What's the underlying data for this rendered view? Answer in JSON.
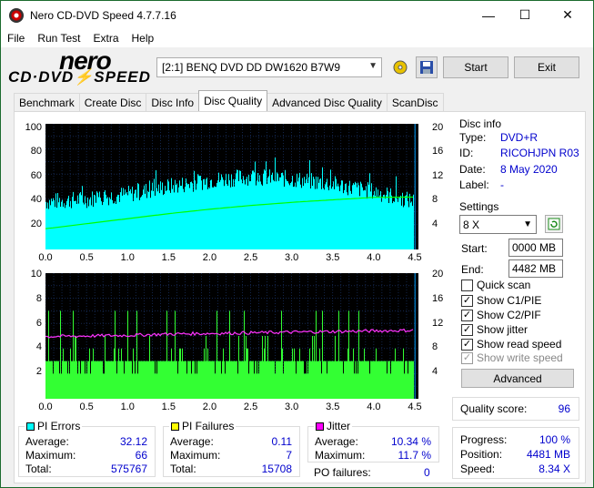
{
  "window": {
    "title": "Nero CD-DVD Speed 4.7.7.16",
    "minimize": "—",
    "maximize": "☐",
    "close": "✕"
  },
  "menu": [
    "File",
    "Run Test",
    "Extra",
    "Help"
  ],
  "logo": {
    "brand": "nero",
    "product": "CD·DVD⚡SPEED"
  },
  "toolbar": {
    "drive": "[2:1]   BENQ DVD DD DW1620 B7W9",
    "start_label": "Start",
    "exit_label": "Exit"
  },
  "tabs": [
    "Benchmark",
    "Create Disc",
    "Disc Info",
    "Disc Quality",
    "Advanced Disc Quality",
    "ScanDisc"
  ],
  "active_tab": "Disc Quality",
  "disc_info": {
    "title": "Disc info",
    "type_label": "Type:",
    "type": "DVD+R",
    "id_label": "ID:",
    "id": "RICOHJPN R03",
    "date_label": "Date:",
    "date": "8 May 2020",
    "label_label": "Label:",
    "label": "-"
  },
  "settings": {
    "title": "Settings",
    "speed": "8 X",
    "start_label": "Start:",
    "start": "0000 MB",
    "end_label": "End:",
    "end": "4482 MB",
    "quick_scan": "Quick scan",
    "show_c1": "Show C1/PIE",
    "show_c2": "Show C2/PIF",
    "show_jitter": "Show jitter",
    "show_read": "Show read speed",
    "show_write": "Show write speed",
    "advanced": "Advanced",
    "checks": {
      "quick_scan": false,
      "show_c1": true,
      "show_c2": true,
      "show_jitter": true,
      "show_read": true,
      "show_write": true
    }
  },
  "quality": {
    "label": "Quality score:",
    "value": "96"
  },
  "progress": {
    "progress_label": "Progress:",
    "progress": "100 %",
    "position_label": "Position:",
    "position": "4481 MB",
    "speed_label": "Speed:",
    "speed": "8.34 X"
  },
  "pi_errors": {
    "title": "PI Errors",
    "color": "#00ffff",
    "avg_label": "Average:",
    "avg": "32.12",
    "max_label": "Maximum:",
    "max": "66",
    "total_label": "Total:",
    "total": "575767"
  },
  "pi_failures": {
    "title": "PI Failures",
    "color": "#ffff00",
    "avg_label": "Average:",
    "avg": "0.11",
    "max_label": "Maximum:",
    "max": "7",
    "total_label": "Total:",
    "total": "15708"
  },
  "jitter": {
    "title": "Jitter",
    "color": "#ff00ff",
    "avg_label": "Average:",
    "avg": "10.34 %",
    "max_label": "Maximum:",
    "max": "11.7 %",
    "po_label": "PO failures:",
    "po": "0"
  },
  "chart_data": [
    {
      "type": "area",
      "title": "",
      "series": [
        {
          "name": "PI Errors",
          "color": "#00ffff"
        },
        {
          "name": "Read speed",
          "color": "#00ff00"
        }
      ],
      "x": [
        0.0,
        0.5,
        1.0,
        1.5,
        2.0,
        2.5,
        3.0,
        3.5,
        4.0,
        4.5
      ],
      "pi_errors": [
        38,
        40,
        44,
        50,
        55,
        58,
        56,
        52,
        46,
        38
      ],
      "read_speed": [
        3.3,
        4.1,
        4.9,
        5.7,
        6.4,
        7.0,
        7.5,
        7.9,
        8.3,
        8.34
      ],
      "xticks": [
        "0.0",
        "0.5",
        "1.0",
        "1.5",
        "2.0",
        "2.5",
        "3.0",
        "3.5",
        "4.0",
        "4.5"
      ],
      "yticks_left": [
        "100",
        "80",
        "60",
        "40",
        "20"
      ],
      "yticks_right": [
        "20",
        "16",
        "12",
        "8",
        "4"
      ],
      "ylim_left": [
        0,
        100
      ],
      "ylim_right": [
        0,
        20
      ],
      "xlim": [
        0,
        4.5
      ],
      "grid": true
    },
    {
      "type": "bar",
      "title": "",
      "series": [
        {
          "name": "PI Failures",
          "color": "#33ff33"
        },
        {
          "name": "Jitter",
          "color": "#ff33ff"
        }
      ],
      "x": [
        0.0,
        0.5,
        1.0,
        1.5,
        2.0,
        2.5,
        3.0,
        3.5,
        4.0,
        4.5
      ],
      "pi_failures_typical": 3,
      "pi_failures_max": 7,
      "jitter": [
        9.9,
        10.0,
        10.1,
        10.3,
        10.4,
        10.5,
        10.6,
        10.7,
        10.8,
        10.9
      ],
      "xticks": [
        "0.0",
        "0.5",
        "1.0",
        "1.5",
        "2.0",
        "2.5",
        "3.0",
        "3.5",
        "4.0",
        "4.5"
      ],
      "yticks_left": [
        "10",
        "8",
        "6",
        "4",
        "2"
      ],
      "yticks_right": [
        "20",
        "16",
        "12",
        "8",
        "4"
      ],
      "ylim_left": [
        0,
        10
      ],
      "ylim_right": [
        0,
        20
      ],
      "xlim": [
        0,
        4.5
      ],
      "grid": true
    }
  ]
}
